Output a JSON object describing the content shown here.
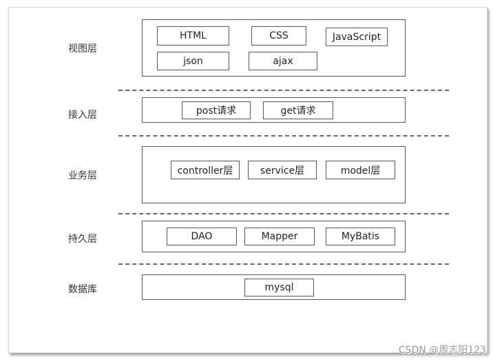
{
  "layers": [
    {
      "label": "视图层",
      "items": [
        "HTML",
        "CSS",
        "JavaScript",
        "json",
        "ajax"
      ]
    },
    {
      "label": "接入层",
      "items": [
        "post请求",
        "get请求"
      ]
    },
    {
      "label": "业务层",
      "items": [
        "controller层",
        "service层",
        "model层"
      ]
    },
    {
      "label": "持久层",
      "items": [
        "DAO",
        "Mapper",
        "MyBatis"
      ]
    },
    {
      "label": "数据库",
      "items": [
        "mysql"
      ]
    }
  ],
  "watermark": "CSDN @周志阳123"
}
